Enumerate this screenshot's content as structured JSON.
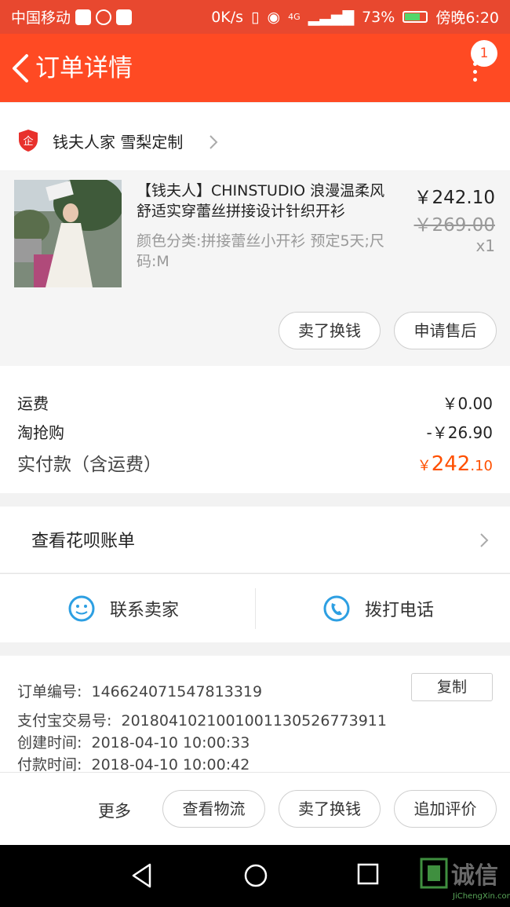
{
  "statusbar": {
    "carrier": "中国移动",
    "speed": "0K/s",
    "network": "4G",
    "battery": "73%",
    "time": "傍晚6:20",
    "battery_level": 0.73
  },
  "header": {
    "title": "订单详情",
    "badge_count": "1"
  },
  "shop": {
    "icon_label": "企",
    "name": "钱夫人家 雪梨定制"
  },
  "product": {
    "title": "【钱夫人】CHINSTUDIO 浪漫温柔风 舒适实穿蕾丝拼接设计针织开衫",
    "sku": "颜色分类:拼接蕾丝小开衫  预定5天;尺码:M",
    "price": "￥242.10",
    "original_price": "￥269.00",
    "quantity": "x1",
    "sell_button": "卖了换钱",
    "aftersale_button": "申请售后"
  },
  "summary": {
    "shipping_label": "运费",
    "shipping_value": "￥0.00",
    "discount_label": "淘抢购",
    "discount_value": "-￥26.90",
    "total_label": "实付款（含运费）",
    "total_currency": "￥",
    "total_int": "242",
    "total_dec": ".10"
  },
  "huabei": {
    "label": "查看花呗账单"
  },
  "contact": {
    "seller_label": "联系卖家",
    "phone_label": "拨打电话"
  },
  "info": {
    "order_no_label": "订单编号:",
    "order_no": "146624071547813319",
    "copy_button": "复制",
    "alipay_label": "支付宝交易号:",
    "alipay_no": "2018041021001001130526773911",
    "created_label": "创建时间:",
    "created_time": "2018-04-10 10:00:33",
    "paid_label": "付款时间:",
    "paid_time": "2018-04-10 10:00:42"
  },
  "bottom": {
    "more": "更多",
    "logistics_button": "查看物流",
    "sell_button": "卖了换钱",
    "review_button": "追加评价"
  },
  "watermark": {
    "text": "诚信",
    "sub": "JiChengXin.com"
  },
  "colors": {
    "header": "#ff4a23",
    "price_accent": "#ff5000",
    "icon_blue": "#2d9fe2"
  }
}
